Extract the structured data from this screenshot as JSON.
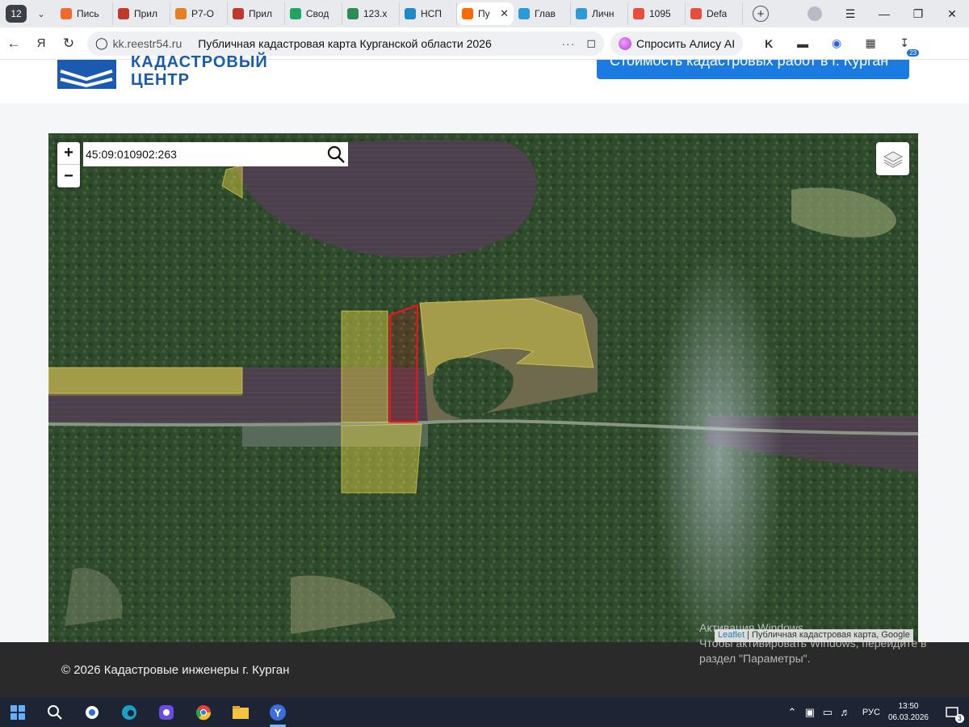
{
  "browser": {
    "tab_count": "12",
    "tabs": [
      {
        "label": "Пись",
        "color": "#f06a2a"
      },
      {
        "label": "Прил",
        "color": "#c0392b"
      },
      {
        "label": "Р7-О",
        "color": "#e67e22"
      },
      {
        "label": "Прил",
        "color": "#c0392b"
      },
      {
        "label": "Свод",
        "color": "#1fa463"
      },
      {
        "label": "123.х",
        "color": "#2e8b57"
      },
      {
        "label": "НСП",
        "color": "#1e88c9"
      },
      {
        "label": "Пу",
        "color": "#ff6a00",
        "active": true
      },
      {
        "label": "Глав",
        "color": "#2a9bd8"
      },
      {
        "label": "Личн",
        "color": "#2a9bd8"
      },
      {
        "label": "1095",
        "color": "#e74c3c"
      },
      {
        "label": "Defa",
        "color": "#e74c3c"
      }
    ],
    "url_domain": "kk.reestr54.ru",
    "page_title": "Публичная кадастровая карта Курганской области 2026",
    "alice_label": "Спросить Алису AI",
    "ext_badge": "23"
  },
  "site": {
    "logo_line1": "КАДАСТРОВЫЙ",
    "logo_line2": "ЦЕНТР",
    "cta_label": "Стоимость кадастровых работ в г. Курган",
    "footer_copy": "© 2026 Кадастровые инженеры г. Курган"
  },
  "map": {
    "search_value": "45:09:010902:263",
    "zoom_in": "+",
    "zoom_out": "−",
    "attribution_link": "Leaflet",
    "attribution_rest": " | Публичная кадастровая карта, Google",
    "selected_parcel_color": "#e3161d",
    "parcel_fill_color": "#e6d84a"
  },
  "overlay": {
    "activation_line1": "Активация Windows",
    "activation_line2": "Чтобы активировать Windows, перейдите в",
    "activation_line3": "раздел \"Параметры\"."
  },
  "taskbar": {
    "language": "РУС",
    "time": "13:50",
    "date": "06.03.2026",
    "notifications": "3"
  }
}
